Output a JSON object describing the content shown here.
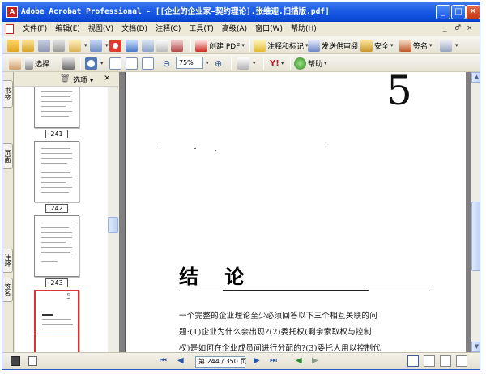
{
  "window": {
    "title": "Adobe Acrobat Professional - [[企业的企业家—契约理论].张维迎.扫描版.pdf]",
    "minimize": "_",
    "maximize": "□",
    "close": "✕"
  },
  "menubar": {
    "items": [
      "文件(F)",
      "编辑(E)",
      "视图(V)",
      "文档(D)",
      "注释(C)",
      "工具(T)",
      "高级(A)",
      "窗口(W)",
      "帮助(H)"
    ],
    "mdi_minimize": "_",
    "mdi_restore": "♂",
    "mdi_close": "×"
  },
  "toolbar1": {
    "create_pdf": "创建 PDF",
    "comment_markup": "注释和标记",
    "send_review": "发送供审阅",
    "secure": "安全",
    "sign": "签名"
  },
  "toolbar2": {
    "select": "选择",
    "zoom_value": "75%",
    "help": "帮助"
  },
  "left_panel": {
    "tabs": [
      "书签",
      "页面",
      "注释",
      "签名"
    ],
    "options": "选项",
    "close": "×",
    "thumbnails": [
      {
        "label": "241"
      },
      {
        "label": "242"
      },
      {
        "label": "243"
      },
      {
        "label": ""
      }
    ]
  },
  "document": {
    "chapter_number": "5",
    "heading": "结  论",
    "body_lines": [
      "一个完整的企业理论至少必须回答以下三个相互关联的问",
      "题:(1)企业为什么会出现?(2)委托权(剩余索取权与控制",
      "权)是如何在企业成员间进行分配的?(3)委托人用以控制代"
    ]
  },
  "statusbar": {
    "page_indicator": "第 244 / 350 页"
  }
}
